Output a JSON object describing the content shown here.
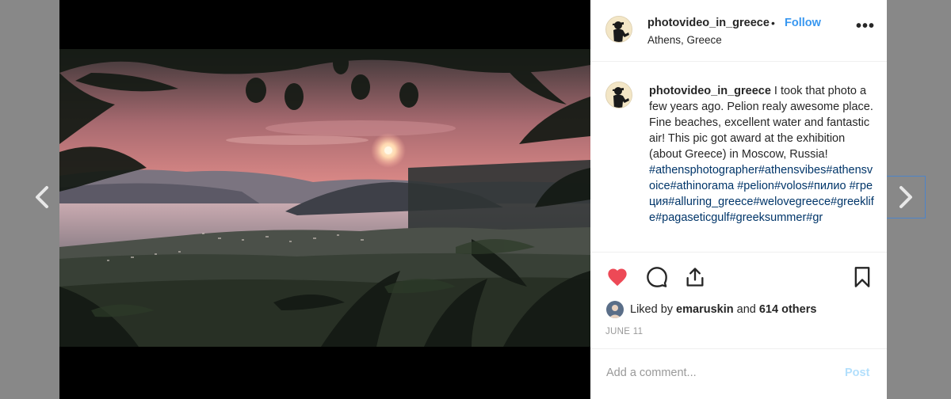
{
  "nav": {
    "prev_icon": "chevron-left-icon",
    "next_icon": "chevron-right-icon"
  },
  "post": {
    "username": "photovideo_in_greece",
    "separator": "•",
    "follow_label": "Follow",
    "location": "Athens, Greece",
    "more_icon": "•••",
    "caption": {
      "username": "photovideo_in_greece",
      "text": " I took that photo a few years ago. Pelion realy awesome place. Fine beaches, excellent water and fantastic air! This pic got award at the exhibition (about Greece) in Moscow, Russia!",
      "hashtags": "#athensphotographer#athensvibes#athensvoice#athinorama #pelion#volos#пилио #греция#alluring_greece#welovegreece#greeklife#pagaseticgulf#greeksummer#gr"
    },
    "likes": {
      "prefix": "Liked by",
      "user": "emaruskin",
      "connector": "and",
      "others": "614 others"
    },
    "date": "JUNE 11",
    "comment_placeholder": "Add a comment...",
    "post_label": "Post",
    "colors": {
      "like_red": "#ed4956",
      "link_blue": "#3897f0",
      "hashtag_blue": "#003569"
    }
  }
}
